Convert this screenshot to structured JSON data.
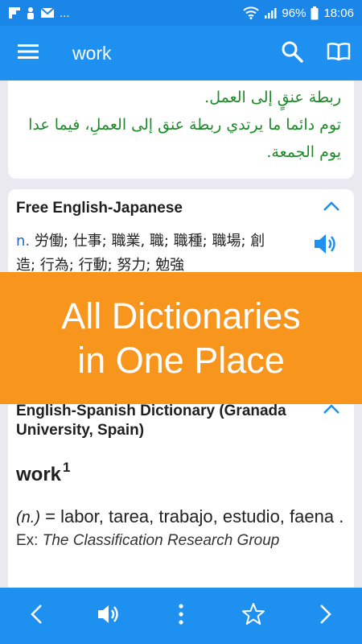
{
  "status_bar": {
    "left_dots": "...",
    "battery": "96%",
    "time": "18:06"
  },
  "app_bar": {
    "title": "work",
    "icons": [
      "menu-icon",
      "search-icon",
      "book-icon"
    ]
  },
  "arabic_card": {
    "lines": [
      "ربطة عنقٍ إلى العمل.",
      "توم دائما ما يرتدي ربطة عنق إلى العملِ، فيما عدا",
      "يوم الجمعة."
    ]
  },
  "japanese_card": {
    "title": "Free English-Japanese",
    "pos": "n.",
    "line1": "労働; 仕事; 職業, 職; 職種; 職場; 創",
    "line2": "造; 行為; 行動; 努力; 勉強"
  },
  "banner": {
    "line1": "All Dictionaries",
    "line2": "in One Place"
  },
  "spanish_card": {
    "title": "English-Spanish Dictionary (Granada University, Spain)",
    "headword": "work",
    "homograph": "1",
    "pos": "(n.)",
    "definition": " = labor, tarea, trabajo, estudio, faena .",
    "example_label": "Ex: ",
    "example_text": "The Classification Research Group"
  },
  "bottom_bar": {
    "icons": [
      "back-icon",
      "volume-icon",
      "more-icon",
      "star-icon",
      "forward-icon"
    ]
  },
  "colors": {
    "primary": "#1e90f0",
    "banner": "#f7951d",
    "arabic_text": "#1e8a2a",
    "pos_blue": "#2266cc"
  }
}
